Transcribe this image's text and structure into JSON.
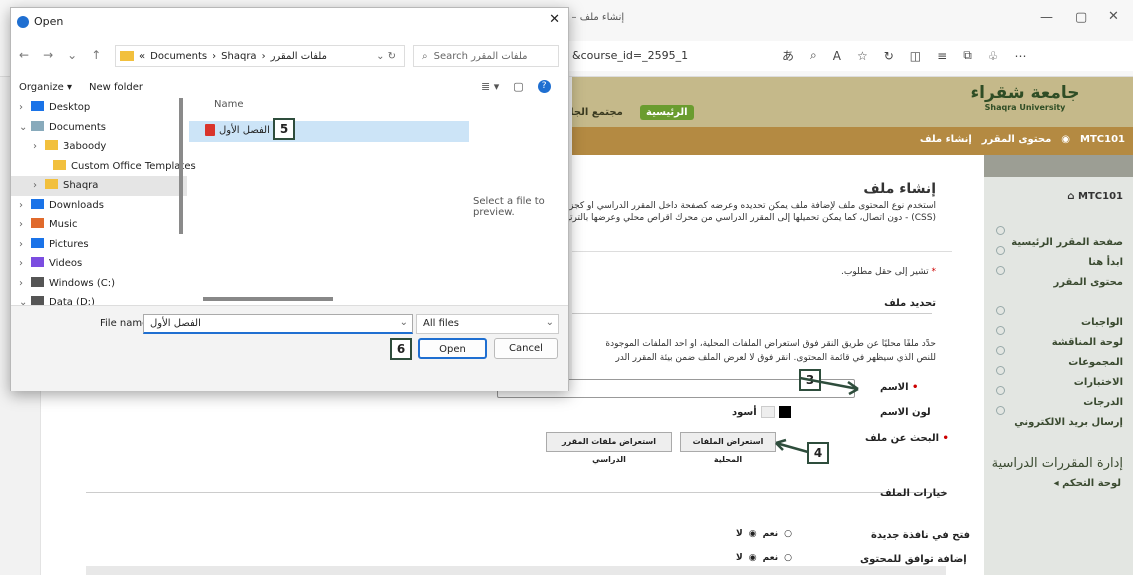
{
  "browser": {
    "tab_title": "إنشاء ملف – 1",
    "url": "&course_id=_2595_1",
    "window_buttons": [
      "—",
      "▢",
      "✕"
    ]
  },
  "banner": {
    "nav_home": "الرئيسية",
    "nav_community": "مجتمع الجاء",
    "logo_ar": "جامعة شقراء",
    "logo_en": "Shaqra University"
  },
  "breadcrumb": {
    "course": "MTC101",
    "content": "محتوى المقرر",
    "current": "إنشاء ملف"
  },
  "sidebar": {
    "course_code": "MTC101",
    "items": [
      "صفحة المقرر الرئيسية",
      "ابدأ هنا",
      "محتوى المقرر",
      "الواجبات",
      "لوحة المناقشة",
      "المجموعات",
      "الاختبارات",
      "الدرجات",
      "إرسال بريد الالكتروني"
    ],
    "manage_title": "إدارة المقررات الدراسية",
    "control_panel": "لوحة التحكم"
  },
  "content": {
    "page_title": "إنشاء ملف",
    "desc_line1": "استخدم نوع المحتوى ملف لإضافة ملف يمكن تحديده وعرضه كصفحة داخل المقرر الدراسي أو كجزء منفصل ع",
    "desc_line2": "(CSS) - دون اتصال، كما يمكن تحميلها إلى المقرر الدراسي من محرك أقراص محلي وعرضها بالترتيب. تعليمات إ",
    "required_note": "تشير إلى حقل مطلوب.",
    "section_select": "تحديد ملف",
    "select_desc1": "حدِّد ملفًا محليًا عن طريق النقر فوق استعراض الملفات المحلية، أو أحد الملفات الموجودة",
    "select_desc2": "للنص الذي سيظهر في قائمة المحتوى. انقر فوق لا لعرض الملف ضمن بيئة المقرر الدر",
    "name_label": "الاسم",
    "name_color_label": "لون الاسم",
    "color_value": "أسود",
    "browse_label": "البحث عن ملف",
    "browse_local": "استعراض الملفات المحلية",
    "browse_course": "استعراض ملفات المقرر الدراسي",
    "section_options": "خيارات الملف",
    "open_new_window": "فتح في نافذة جديدة",
    "add_compat": "إضافة توافق للمحتوى",
    "yes": "نعم",
    "no": "لا"
  },
  "dialog": {
    "title": "Open",
    "close": "✕",
    "breadcrumb": [
      "Documents",
      "Shaqra",
      "ملفات المقرر"
    ],
    "search_placeholder": "Search ملفات المقرر",
    "organize": "Organize ▾",
    "new_folder": "New folder",
    "tree": [
      "Desktop",
      "Documents",
      "3aboody",
      "Custom Office Templates",
      "Shaqra",
      "Downloads",
      "Music",
      "Pictures",
      "Videos",
      "Windows (C:)",
      "Data (D:)"
    ],
    "column_name": "Name",
    "file_name": "الفصل الأول",
    "preview_text": "Select a file to preview.",
    "file_name_label": "File name:",
    "file_name_value": "الفصل الأول",
    "file_type": "All files",
    "open_button": "Open",
    "cancel_button": "Cancel"
  },
  "callouts": [
    "3",
    "4",
    "5",
    "6"
  ],
  "colors": {
    "accent_green": "#6a9c2f",
    "strip_brown": "#b48a42",
    "callout_border": "#2e4d3c",
    "selection_blue": "#cce4f7"
  }
}
